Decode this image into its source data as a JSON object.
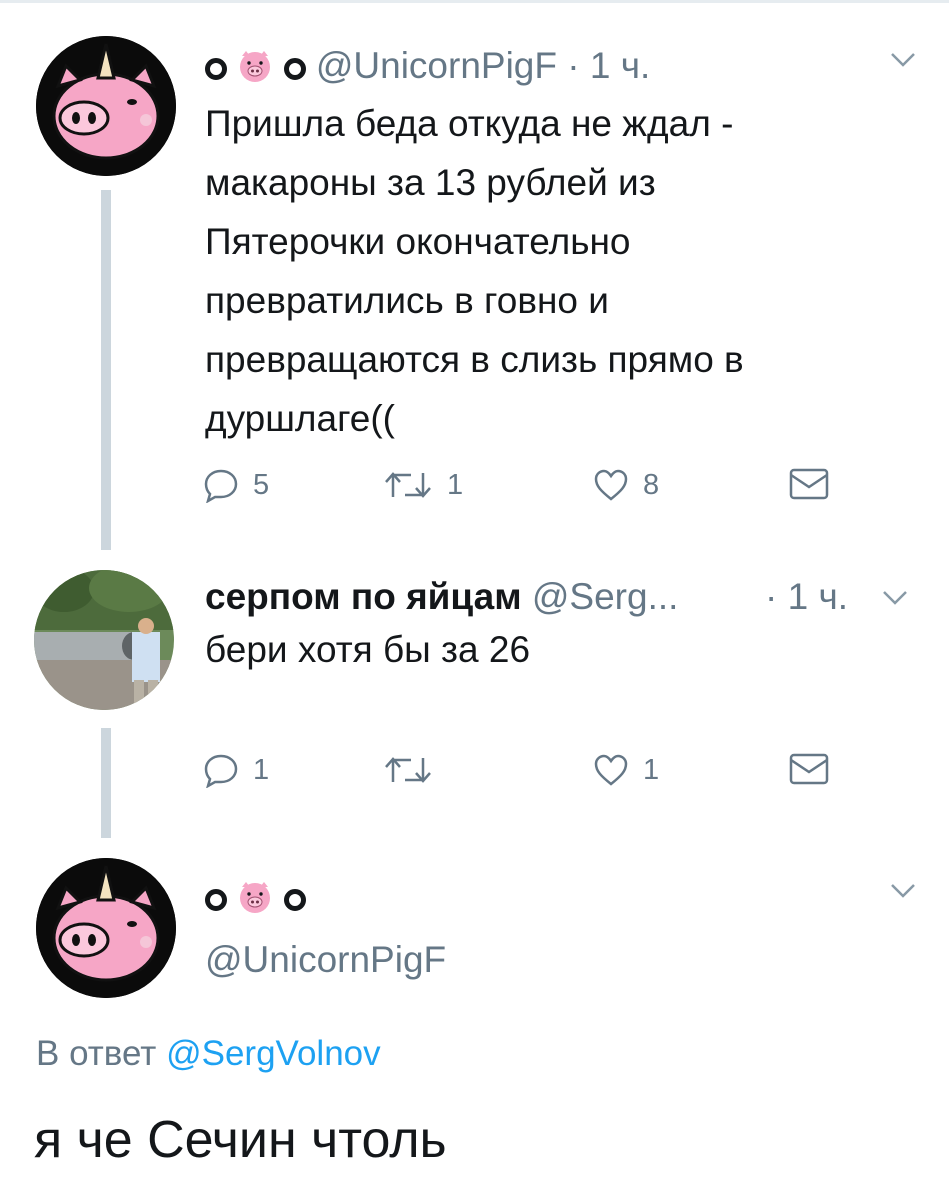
{
  "tweet1": {
    "name_left": "O",
    "name_pig": "pig-face-icon",
    "name_right": "O",
    "handle": "@UnicornPigF",
    "time": "· 1 ч.",
    "text_lines": [
      "Пришла беда откуда не ждал -",
      "макароны за 13 рублей из",
      "Пятерочки окончательно",
      "превратились в говно и",
      "превращаются в слизь прямо в",
      "дуршлаге(("
    ],
    "replies": "5",
    "retweets": "1",
    "likes": "8"
  },
  "tweet2": {
    "name": "серпом по яйцам",
    "handle": "@Serg...",
    "time": "· 1 ч.",
    "text": "бери хотя бы за 26",
    "replies": "1",
    "retweets": "",
    "likes": "1"
  },
  "tweet3": {
    "name_left": "O",
    "name_right": "O",
    "handle": "@UnicornPigF",
    "reply_prefix": "В ответ",
    "reply_mention": "@SergVolnov",
    "text": "я че Сечин чтоль"
  },
  "colors": {
    "text": "#14171a",
    "muted": "#657786",
    "link": "#1da1f2",
    "thread_line": "#ccd6dd",
    "pig_pink": "#f6a6c6"
  }
}
